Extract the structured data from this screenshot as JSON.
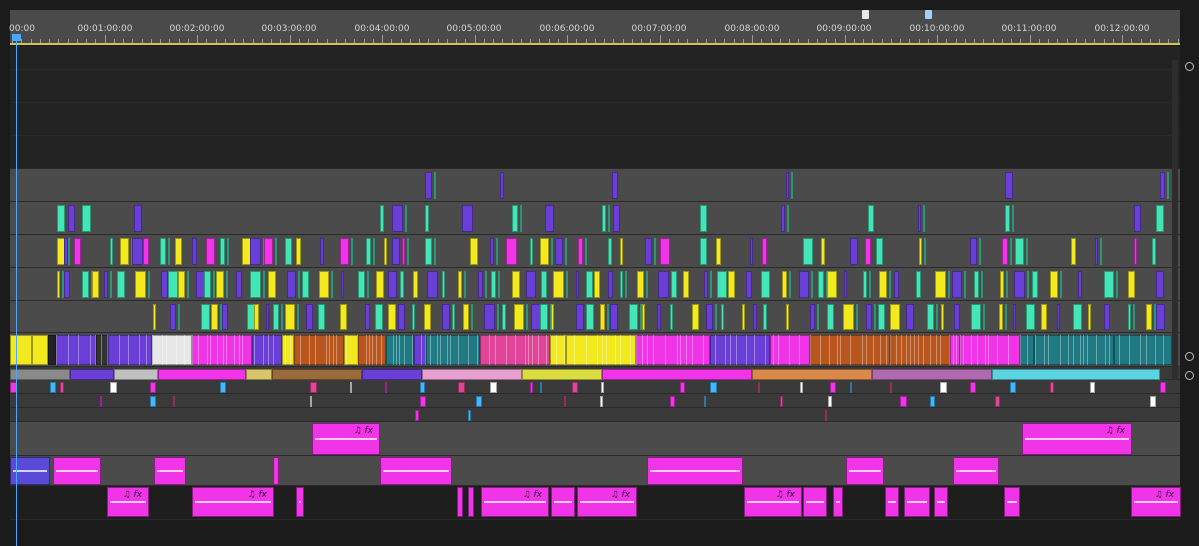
{
  "ruler": {
    "timecodes": [
      "00:00",
      "00:01:00:00",
      "00:02:00:00",
      "00:03:00:00",
      "00:04:00:00",
      "00:05:00:00",
      "00:06:00:00",
      "00:07:00:00",
      "00:08:00:00",
      "00:09:00:00",
      "00:10:00:00",
      "00:11:00:00",
      "00:12:00:00"
    ]
  },
  "colors": {
    "purple": "#6a3fd8",
    "mint": "#43e6b6",
    "yellow": "#f2ea1f",
    "magenta": "#f234e8",
    "teal": "#1f7a84",
    "orange": "#b8561e",
    "pink": "#e0459a",
    "rust": "#b04a20",
    "crimson": "#c0303e",
    "gray_lane": "#4b4b4b",
    "dark_lane": "#232323"
  },
  "audio_labels": {
    "note": "♫",
    "fx": "fx"
  }
}
